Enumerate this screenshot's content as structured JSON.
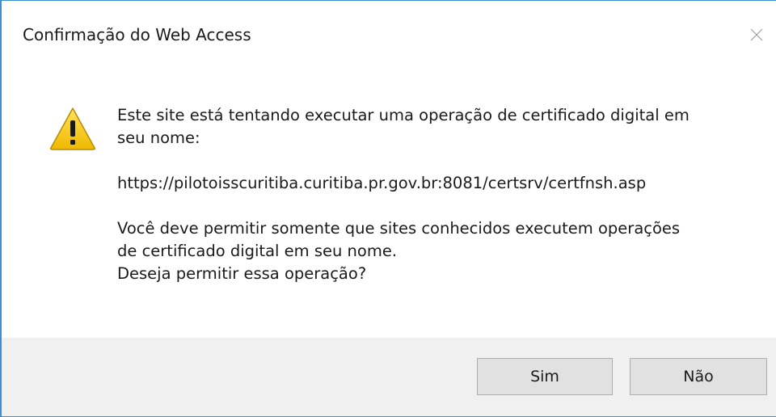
{
  "window": {
    "title": "Confirmação do Web Access"
  },
  "icons": {
    "status": "warning-icon",
    "close": "close-icon"
  },
  "message": {
    "line1": "Este site está tentando executar uma operação de certificado digital em",
    "line2": "seu nome:",
    "url": "https://pilotoisscuritiba.curitiba.pr.gov.br:8081/certsrv/certfnsh.asp",
    "line3": "Você deve permitir somente que sites conhecidos executem operações",
    "line4": "de certificado digital em seu nome.",
    "line5": "Deseja permitir essa operação?"
  },
  "buttons": {
    "yes_label": "Sim",
    "no_label": "Não"
  },
  "colors": {
    "accent_border": "#3c8fd4",
    "footer_bg": "#f0f0f0",
    "button_bg": "#e1e1e1",
    "warning_yellow": "#f5c400"
  }
}
